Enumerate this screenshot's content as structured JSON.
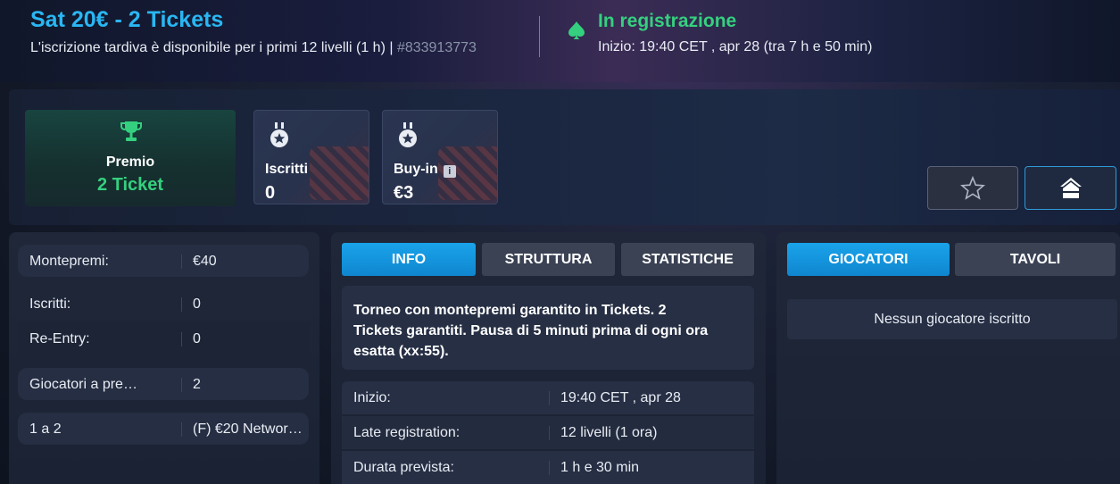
{
  "header": {
    "title": "Sat 20€ - 2 Tickets",
    "subtitle": "L'iscrizione tardiva è disponibile per i primi 12 livelli (1 h) | ",
    "tournament_id": "#833913773",
    "status": "In registrazione",
    "start": "Inizio: 19:40 CET , apr 28 (tra 7 h e 50 min)"
  },
  "summary": {
    "prize_label": "Premio",
    "prize_value": "2 Ticket",
    "entrants_label": "Iscritti",
    "entrants_value": "0",
    "buyin_label": "Buy-in",
    "buyin_value": "€3",
    "info_glyph": "i"
  },
  "left_panel": {
    "rows": [
      {
        "label": "Montepremi:",
        "value": "€40"
      },
      {
        "label": "Iscritti:",
        "value": "0"
      },
      {
        "label": "Re-Entry:",
        "value": "0"
      },
      {
        "label": "Giocatori a pre…",
        "value": "2"
      },
      {
        "label": "1  a  2",
        "value": "(F) €20 Networ…"
      }
    ]
  },
  "middle_panel": {
    "tabs": [
      "INFO",
      "STRUTTURA",
      "STATISTICHE"
    ],
    "description": "Torneo  con montepremi garantito in Tickets. 2 Tickets garantiti. Pausa di 5 minuti prima di ogni ora esatta (xx:55).",
    "rows": [
      {
        "label": "Inizio:",
        "value": "19:40 CET , apr 28"
      },
      {
        "label": "Late registration:",
        "value": "12 livelli (1 ora)"
      },
      {
        "label": "Durata prevista:",
        "value": "1 h e 30 min"
      }
    ]
  },
  "right_panel": {
    "tabs": [
      "GIOCATORI",
      "TAVOLI"
    ],
    "empty_message": "Nessun giocatore iscritto"
  },
  "colors": {
    "accent_blue": "#29b7f3",
    "status_green": "#35d07f",
    "tab_active": "#1aa3ea"
  },
  "icons": [
    "spade-icon",
    "trophy-icon",
    "medal-icon",
    "info-icon",
    "star-icon",
    "home-icon"
  ]
}
